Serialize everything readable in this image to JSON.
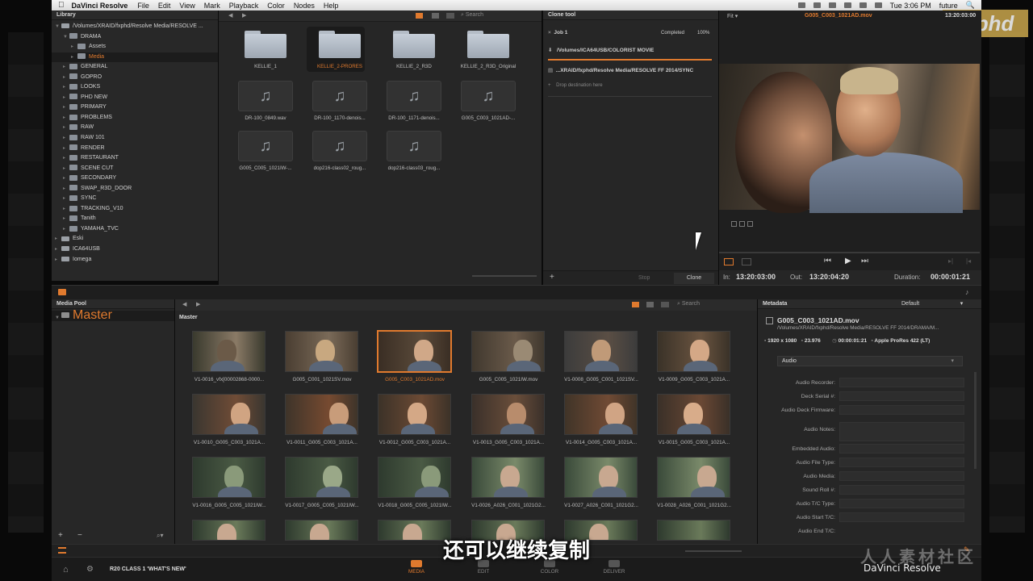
{
  "menubar": {
    "app": "DaVinci Resolve",
    "items": [
      "File",
      "Edit",
      "View",
      "Mark",
      "Playback",
      "Color",
      "Nodes",
      "Help"
    ],
    "clock": "Tue 3:06 PM",
    "user": "future",
    "search_glyph": "🔍"
  },
  "brand": {
    "logo": "fxphd",
    "footer": "DaVinci Resolve",
    "watermark_cn": "人人素材社区"
  },
  "library": {
    "title": "Library",
    "root": "/Volumes/XRAID/fxphd/Resolve Media/RESOLVE ...",
    "tree": [
      {
        "label": "DRAMA",
        "depth": 1
      },
      {
        "label": "Assets",
        "depth": 2
      },
      {
        "label": "Media",
        "depth": 2,
        "selected": true
      },
      {
        "label": "GENERAL",
        "depth": 1
      },
      {
        "label": "GOPRO",
        "depth": 1
      },
      {
        "label": "LOOKS",
        "depth": 1
      },
      {
        "label": "PHD NEW",
        "depth": 1
      },
      {
        "label": "PRIMARY",
        "depth": 1
      },
      {
        "label": "PROBLEMS",
        "depth": 1
      },
      {
        "label": "RAW",
        "depth": 1
      },
      {
        "label": "RAW 101",
        "depth": 1
      },
      {
        "label": "RENDER",
        "depth": 1
      },
      {
        "label": "RESTAURANT",
        "depth": 1
      },
      {
        "label": "SCENE CUT",
        "depth": 1
      },
      {
        "label": "SECONDARY",
        "depth": 1
      },
      {
        "label": "SWAP_R3D_DOOR",
        "depth": 1
      },
      {
        "label": "SYNC",
        "depth": 1
      },
      {
        "label": "TRACKING_V10",
        "depth": 1
      },
      {
        "label": "Tanith",
        "depth": 1
      },
      {
        "label": "YAMAHA_TVC",
        "depth": 1
      },
      {
        "label": "Eski",
        "depth": 0,
        "drive": true
      },
      {
        "label": "ICA64USB",
        "depth": 0,
        "drive": true
      },
      {
        "label": "Iomega",
        "depth": 0,
        "drive": true
      }
    ]
  },
  "browser": {
    "search_placeholder": "Search",
    "folders": [
      "KELLIE_1",
      "KELLIE_2-PRORES",
      "KELLIE_2_R3D",
      "KELLIE_2_R3D_Original"
    ],
    "selected_folder": "KELLIE_2-PRORES",
    "audio_files": [
      "DR-100_0849.wav",
      "DR-100_1170-denois...",
      "DR-100_1171-denois...",
      "G005_C003_1021AD-...",
      "G005_C005_1021IW-...",
      "dop216-class02_roug...",
      "dop216-class03_roug..."
    ]
  },
  "clone": {
    "title": "Clone tool",
    "job": "Job 1",
    "status": "Completed",
    "percent": "100%",
    "source": "/Volumes/ICA64USB/COLORIST MOVIE",
    "destination": "...XRAID/fxphd/Resolve Media/RESOLVE FF 2014/SYNC",
    "drop_hint": "Drop destination here",
    "stop_label": "Stop",
    "clone_label": "Clone"
  },
  "viewer": {
    "fit": "Fit",
    "clip": "G005_C003_1021AD.mov",
    "timecode": "13:20:03:00",
    "in_label": "In:",
    "in": "13:20:03:00",
    "out_label": "Out:",
    "out": "13:20:04:20",
    "duration_label": "Duration:",
    "duration": "00:00:01:21"
  },
  "mediapool": {
    "title": "Media Pool",
    "bin": "Master",
    "section": "Master",
    "search_placeholder": "Search",
    "clips": [
      "V1-0016_vfx[00002868-0000...",
      "G005_C001_1021SV.mov",
      "G005_C003_1021AD.mov",
      "G005_C005_1021IW.mov",
      "V1-0008_G005_C001_1021SV...",
      "V1-0009_G005_C003_1021A...",
      "V1-0010_G005_C003_1021A...",
      "V1-0011_G005_C003_1021A...",
      "V1-0012_G005_C003_1021A...",
      "V1-0013_G005_C003_1021A...",
      "V1-0014_G005_C003_1021A...",
      "V1-0015_G005_C003_1021A...",
      "V1-0016_G005_C005_1021IW...",
      "V1-0017_G005_C005_1021IW...",
      "V1-0018_G005_C005_1021IW...",
      "V1-0026_A026_C001_1021G2...",
      "V1-0027_A026_C001_1021G2...",
      "V1-0028_A026_C001_1021G2..."
    ],
    "selected_clip": "G005_C003_1021AD.mov"
  },
  "metadata": {
    "title": "Metadata",
    "preset": "Default",
    "clip_name": "G005_C003_1021AD.mov",
    "clip_path": "/Volumes/XRAID/fxphd/Resolve Media/RESOLVE FF 2014/DRAMA/M...",
    "resolution": "1920 x 1080",
    "fps": "23.976",
    "duration": "00:00:01:21",
    "codec": "Apple ProRes 422 (LT)",
    "group": "Audio",
    "fields": [
      "Audio Recorder:",
      "Deck Serial #:",
      "Audio Deck Firmware:",
      "Audio Notes:",
      "Embedded Audio:",
      "Audio File Type:",
      "Audio Media:",
      "Sound Roll #:",
      "Audio T/C Type:",
      "Audio Start T/C:",
      "Audio End T/C:"
    ]
  },
  "bottom": {
    "project": "R20 CLASS 1 'WHAT'S NEW'",
    "tabs": [
      "MEDIA",
      "EDIT",
      "COLOR",
      "DELIVER"
    ],
    "active_tab": "MEDIA"
  },
  "subtitle": "还可以继续复制"
}
